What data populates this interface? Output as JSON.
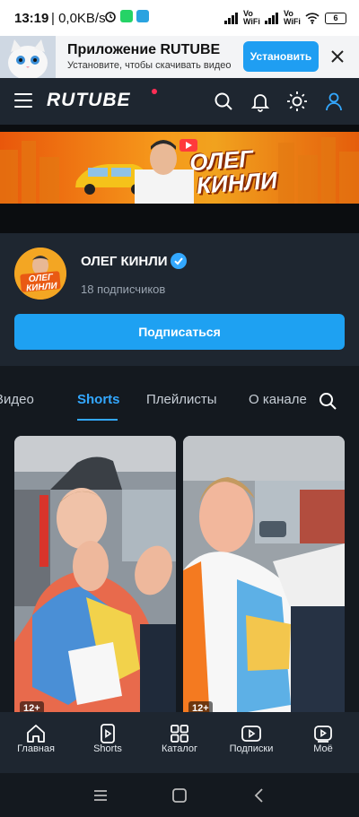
{
  "status_bar": {
    "time": "13:19",
    "speed": "| 0,0KB/s",
    "network1": "Vo WiFi",
    "network2": "Vo WiFi",
    "battery": "6"
  },
  "app_banner": {
    "title": "Приложение RUTUBE",
    "subtitle": "Установите, чтобы скачивать видео",
    "install_label": "Установить"
  },
  "header": {
    "logo": "RUTUBE"
  },
  "cover": {
    "title_line1": "ОЛЕГ",
    "title_line2": "КИНЛИ"
  },
  "channel": {
    "name": "ОЛЕГ КИНЛИ",
    "subscribers": "18 подписчиков",
    "subscribe_label": "Подписаться",
    "avatar_text": "ОЛЕГ КИНЛИ"
  },
  "tabs": [
    {
      "label": "Видео",
      "active": false
    },
    {
      "label": "Shorts",
      "active": true
    },
    {
      "label": "Плейлисты",
      "active": false
    },
    {
      "label": "О канале",
      "active": false
    }
  ],
  "shorts": [
    {
      "age": "12+"
    },
    {
      "age": "12+"
    }
  ],
  "bottom_nav": [
    {
      "label": "Главная",
      "icon": "home-icon"
    },
    {
      "label": "Shorts",
      "icon": "shorts-icon"
    },
    {
      "label": "Каталог",
      "icon": "catalog-icon"
    },
    {
      "label": "Подписки",
      "icon": "subscriptions-icon"
    },
    {
      "label": "Моё",
      "icon": "my-icon"
    }
  ],
  "colors": {
    "accent": "#1ea1f2",
    "tab_active": "#33a8ff",
    "background": "#14191f",
    "panel": "#1e2630",
    "logo_dot": "#ff2e55"
  }
}
